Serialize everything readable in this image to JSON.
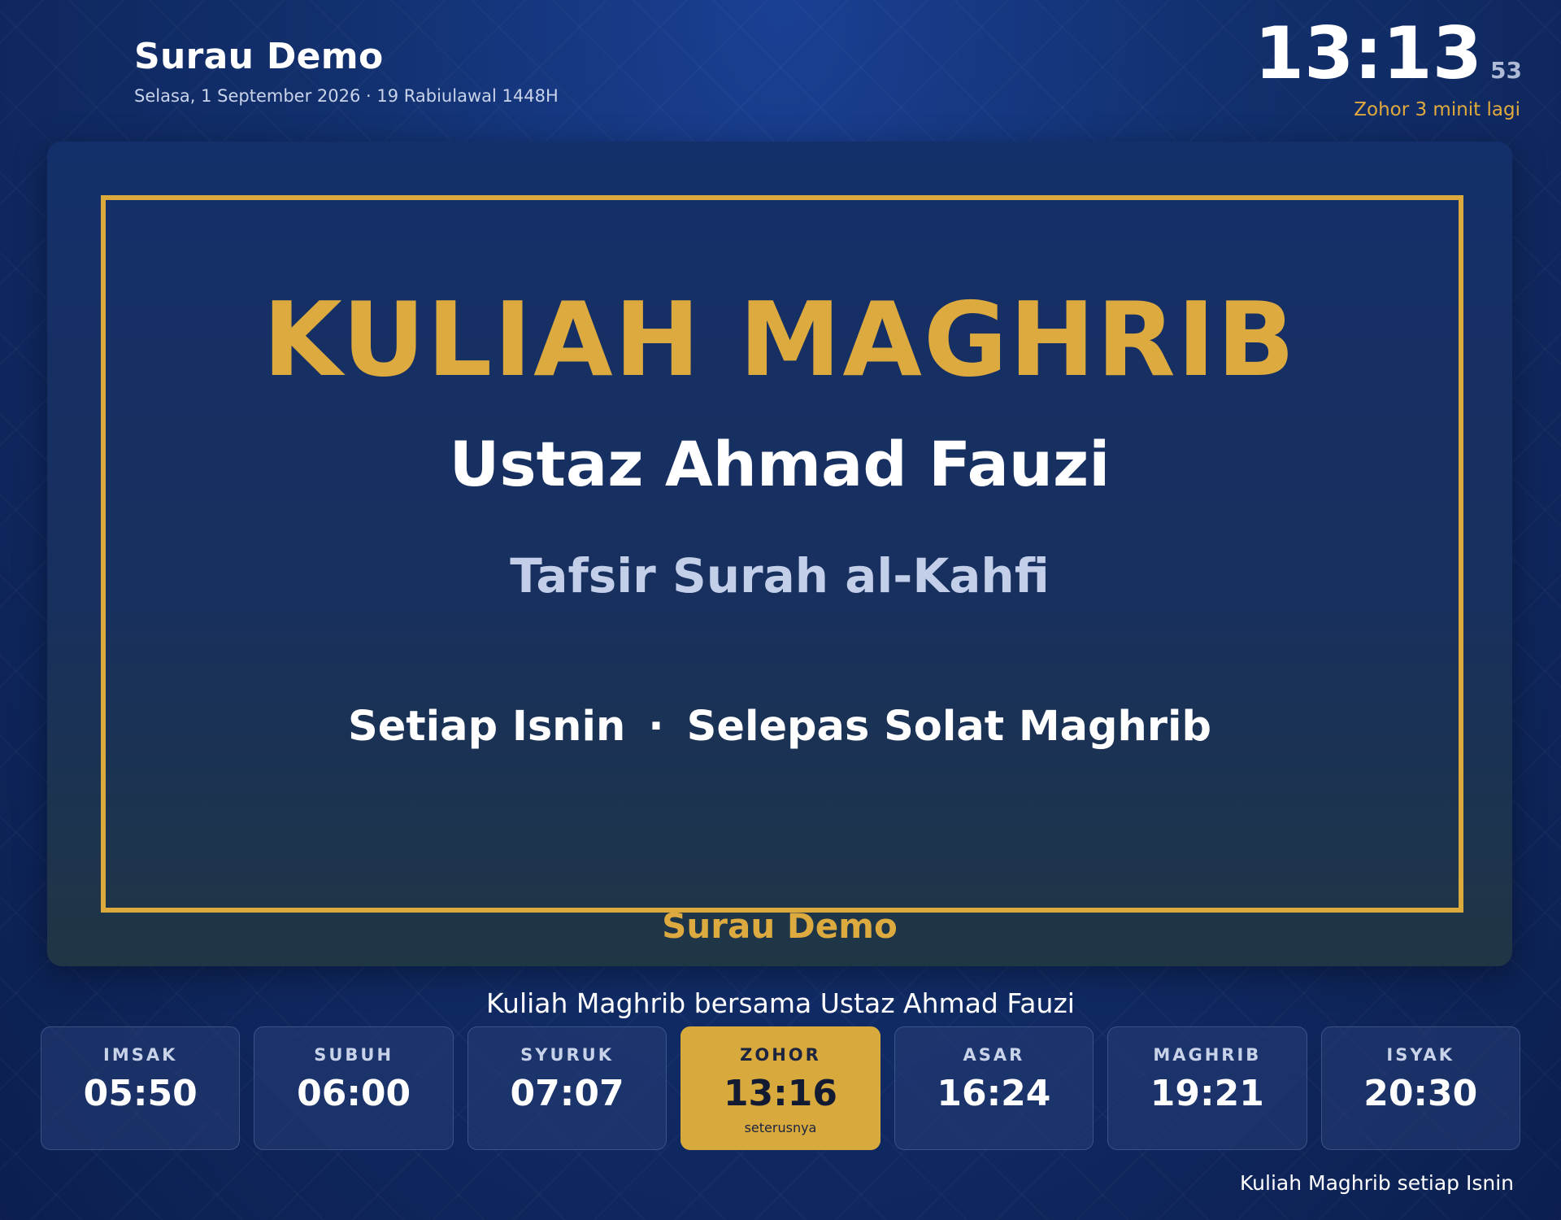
{
  "header": {
    "site_name": "Surau Demo",
    "date_line": "Selasa, 1 September 2026 · 19 Rabiulawal 1448H",
    "clock_hm": "13:13",
    "clock_sec": "53",
    "countdown": "Zohor 3 minit lagi"
  },
  "slide": {
    "title": "KULIAH MAGHRIB",
    "speaker": "Ustaz Ahmad Fauzi",
    "topic": "Tafsir Surah al-Kahfi",
    "schedule_day": "Setiap Isnin",
    "schedule_sep": "·",
    "schedule_time": "Selepas Solat Maghrib",
    "footer": "Surau Demo"
  },
  "caption": "Kuliah Maghrib bersama Ustaz Ahmad Fauzi",
  "prayers": [
    {
      "name": "IMSAK",
      "time": "05:50"
    },
    {
      "name": "SUBUH",
      "time": "06:00"
    },
    {
      "name": "SYURUK",
      "time": "07:07"
    },
    {
      "name": "ZOHOR",
      "time": "13:16",
      "note": "seterusnya"
    },
    {
      "name": "ASAR",
      "time": "16:24"
    },
    {
      "name": "MAGHRIB",
      "time": "19:21"
    },
    {
      "name": "ISYAK",
      "time": "20:30"
    }
  ],
  "ticker": "Kuliah Maghrib setiap Isnin",
  "colors": {
    "accent_gold": "#dcaa3e",
    "background_navy": "#12306e"
  }
}
